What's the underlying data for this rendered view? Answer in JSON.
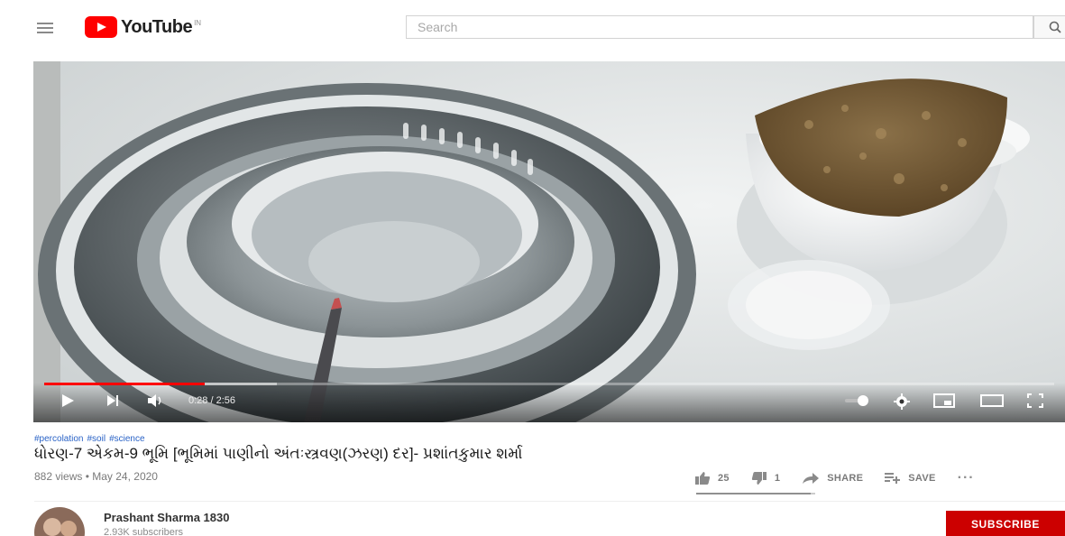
{
  "masthead": {
    "logo_text": "YouTube",
    "country_code": "IN",
    "search_placeholder": "Search"
  },
  "player": {
    "time_current": "0:28",
    "time_separator": " / ",
    "time_total": "2:56",
    "progress_fraction": 0.159,
    "buffered_fraction": 0.23
  },
  "video": {
    "hashtags": [
      "#percolation",
      "#soil",
      "#science"
    ],
    "title": "ધોરણ-7 એકમ-9 ભૂમિ [ભૂમિમાં પાણીનો અંતઃસ્ત્રવણ(ઝરણ) દર]- પ્રશાંતકુમાર શર્મા",
    "views": "882 views",
    "meta_separator": " • ",
    "date": "May 24, 2020",
    "likes": "25",
    "dislikes": "1",
    "share_label": "SHARE",
    "save_label": "SAVE",
    "more_label": "···",
    "like_fraction": 0.96
  },
  "channel": {
    "name": "Prashant Sharma 1830",
    "subscribers": "2.93K subscribers",
    "subscribe_label": "SUBSCRIBE"
  },
  "colors": {
    "brand_red": "#ff0000",
    "subscribe_red": "#cc0000",
    "hashtag_blue": "#2962c6"
  }
}
